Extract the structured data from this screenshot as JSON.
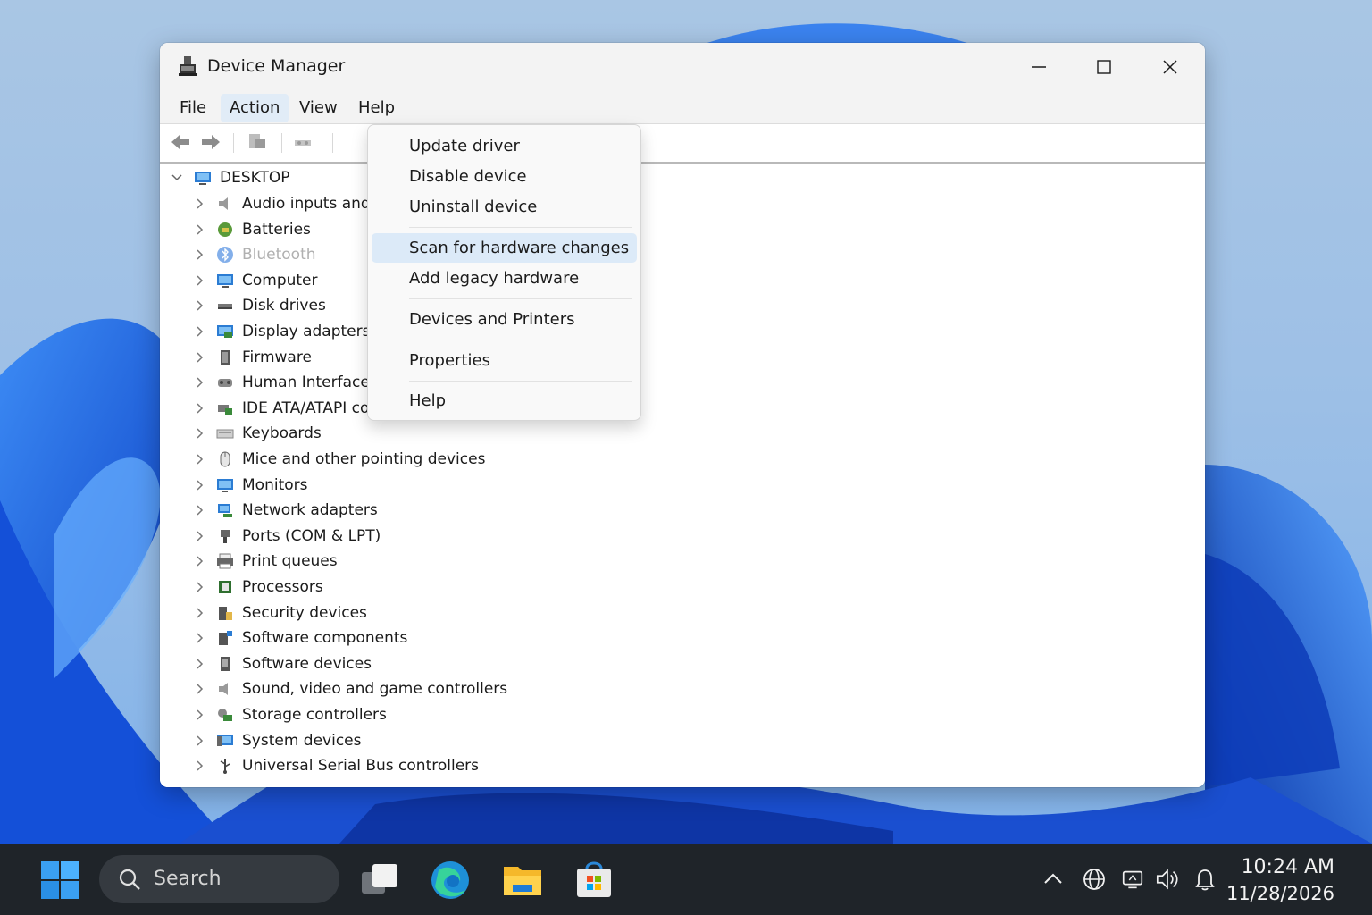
{
  "window": {
    "title": "Device Manager"
  },
  "menubar": [
    {
      "label": "File",
      "active": false
    },
    {
      "label": "Action",
      "active": true
    },
    {
      "label": "View",
      "active": false
    },
    {
      "label": "Help",
      "active": false
    }
  ],
  "toolbar": {
    "buttons": [
      "back-arrow-icon",
      "forward-arrow-icon",
      "properties-icon",
      "scan-hardware-icon"
    ]
  },
  "tree": {
    "root": "DESKTOP",
    "items": [
      {
        "label": "Audio inputs and o",
        "icon": "speaker-icon",
        "disabled": false
      },
      {
        "label": "Batteries",
        "icon": "battery-icon",
        "disabled": false
      },
      {
        "label": "Bluetooth",
        "icon": "bluetooth-icon",
        "disabled": true
      },
      {
        "label": "Computer",
        "icon": "computer-icon",
        "disabled": false
      },
      {
        "label": "Disk drives",
        "icon": "disk-drive-icon",
        "disabled": false
      },
      {
        "label": "Display adapters",
        "icon": "display-adapter-icon",
        "disabled": false
      },
      {
        "label": "Firmware",
        "icon": "firmware-icon",
        "disabled": false
      },
      {
        "label": "Human Interface De",
        "icon": "hid-icon",
        "disabled": false
      },
      {
        "label": "IDE ATA/ATAPI cont",
        "icon": "ide-controller-icon",
        "disabled": false
      },
      {
        "label": "Keyboards",
        "icon": "keyboard-icon",
        "disabled": false
      },
      {
        "label": "Mice and other pointing devices",
        "icon": "mouse-icon",
        "disabled": false
      },
      {
        "label": "Monitors",
        "icon": "monitor-icon",
        "disabled": false
      },
      {
        "label": "Network adapters",
        "icon": "network-adapter-icon",
        "disabled": false
      },
      {
        "label": "Ports (COM & LPT)",
        "icon": "port-icon",
        "disabled": false
      },
      {
        "label": "Print queues",
        "icon": "printer-icon",
        "disabled": false
      },
      {
        "label": "Processors",
        "icon": "processor-icon",
        "disabled": false
      },
      {
        "label": "Security devices",
        "icon": "security-device-icon",
        "disabled": false
      },
      {
        "label": "Software components",
        "icon": "software-component-icon",
        "disabled": false
      },
      {
        "label": "Software devices",
        "icon": "software-device-icon",
        "disabled": false
      },
      {
        "label": "Sound, video and game controllers",
        "icon": "sound-icon",
        "disabled": false
      },
      {
        "label": "Storage controllers",
        "icon": "storage-controller-icon",
        "disabled": false
      },
      {
        "label": "System devices",
        "icon": "system-device-icon",
        "disabled": false
      },
      {
        "label": "Universal Serial Bus controllers",
        "icon": "usb-icon",
        "disabled": false
      }
    ]
  },
  "context_menu": {
    "items": [
      {
        "label": "Update driver",
        "highlighted": false
      },
      {
        "label": "Disable device",
        "highlighted": false
      },
      {
        "label": "Uninstall device",
        "highlighted": false
      },
      {
        "label": "Scan for hardware changes",
        "highlighted": true
      },
      {
        "label": "Add legacy hardware",
        "highlighted": false
      },
      {
        "label": "Devices and Printers",
        "highlighted": false
      },
      {
        "label": "Properties",
        "highlighted": false
      },
      {
        "label": "Help",
        "highlighted": false
      }
    ]
  },
  "taskbar": {
    "search_label": "Search",
    "apps": [
      "task-view-icon",
      "edge-icon",
      "file-explorer-icon",
      "store-icon"
    ],
    "tray": [
      "chevron-up-icon",
      "globe-icon",
      "network-icon",
      "volume-icon",
      "bell-icon"
    ],
    "time": "10:24 AM",
    "date": "11/28/2026"
  },
  "colors": {
    "accent": "#0067c0",
    "highlight": "#dceaf8",
    "taskbar": "#1f2429"
  }
}
